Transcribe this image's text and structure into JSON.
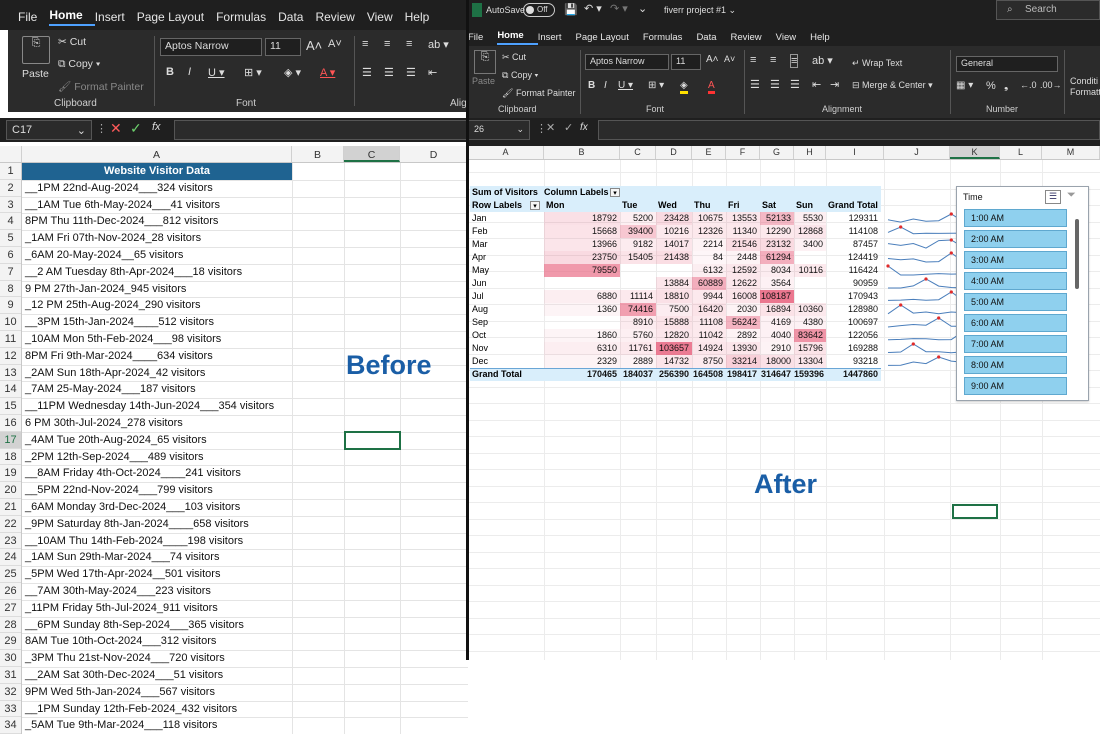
{
  "left": {
    "menu": [
      "File",
      "Home",
      "Insert",
      "Page Layout",
      "Formulas",
      "Data",
      "Review",
      "View",
      "Help"
    ],
    "active_tab": "Home",
    "clipboard": {
      "paste": "Paste",
      "cut": "Cut",
      "copy": "Copy",
      "format_painter": "Format Painter",
      "group": "Clipboard"
    },
    "font": {
      "name": "Aptos Narrow",
      "size": "11",
      "group": "Font"
    },
    "align_group": "Alig",
    "name_box": "C17",
    "fx": "fx",
    "columns": [
      "A",
      "B",
      "C",
      "D"
    ],
    "rows": [
      "1",
      "2",
      "3",
      "4",
      "5",
      "6",
      "7",
      "8",
      "9",
      "10",
      "11",
      "12",
      "13",
      "14",
      "15",
      "16",
      "17",
      "18",
      "19",
      "20",
      "21",
      "22",
      "23",
      "24",
      "25",
      "26",
      "27",
      "28",
      "29",
      "30",
      "31",
      "32",
      "33",
      "34"
    ],
    "title": "Website Visitor Data",
    "data": [
      "__1PM 22nd-Aug-2024___324 visitors",
      "__1AM   Tue 6th-May-2024___41 visitors",
      "8PM   Thu 11th-Dec-2024___812 visitors",
      "_1AM   Fri 07th-Nov-2024_28 visitors",
      "_6AM 20-May-2024__65 visitors",
      "__2 AM  Tuesday 8th-Apr-2024___18 visitors",
      "9 PM 27th-Jan-2024_945 visitors",
      "_12 PM 25th-Aug-2024_290 visitors",
      "__3PM 15th-Jan-2024____512 visitors",
      "_10AM   Mon 5th-Feb-2024___98 visitors",
      "8PM   Fri 9th-Mar-2024____634 visitors",
      "_2AM  Sun 18th-Apr-2024_42 visitors",
      "_7AM 25-May-2024___187 visitors",
      "__11PM  Wednesday 14th-Jun-2024___354 visitors",
      "6 PM 30th-Jul-2024_278 visitors",
      "_4AM  Tue 20th-Aug-2024_65 visitors",
      "_2PM  12th-Sep-2024___489 visitors",
      "__8AM  Friday 4th-Oct-2024____241 visitors",
      "__5PM  22nd-Nov-2024___799 visitors",
      "_6AM  Monday 3rd-Dec-2024___103 visitors",
      "_9PM  Saturday 8th-Jan-2024____658 visitors",
      "__10AM  Thu 14th-Feb-2024____198 visitors",
      "_1AM  Sun 29th-Mar-2024___74 visitors",
      "_5PM  Wed 17th-Apr-2024__501 visitors",
      "__7AM  30th-May-2024___223 visitors",
      "_11PM   Friday 5th-Jul-2024_911 visitors",
      "__6PM  Sunday 8th-Sep-2024___365 visitors",
      "8AM  Tue 10th-Oct-2024___312 visitors",
      "_3PM   Thu 21st-Nov-2024___720 visitors",
      "__2AM   Sat 30th-Dec-2024___51 visitors",
      "9PM  Wed 5th-Jan-2024___567 visitors",
      "__1PM   Sunday 12th-Feb-2024_432 visitors",
      "_5AM  Tue 9th-Mar-2024___118 visitors"
    ],
    "label": "Before"
  },
  "right": {
    "autosave": "AutoSave",
    "autosave_state": "Off",
    "file_name": "fiverr project #1",
    "search": "Search",
    "menu": [
      "File",
      "Home",
      "Insert",
      "Page Layout",
      "Formulas",
      "Data",
      "Review",
      "View",
      "Help"
    ],
    "active_tab": "Home",
    "clipboard": {
      "paste": "Paste",
      "cut": "Cut",
      "copy": "Copy",
      "format_painter": "Format Painter",
      "group": "Clipboard"
    },
    "font": {
      "name": "Aptos Narrow",
      "size": "11",
      "group": "Font"
    },
    "alignment": {
      "wrap": "Wrap Text",
      "merge": "Merge & Center",
      "group": "Alignment"
    },
    "number": {
      "format": "General",
      "group": "Number"
    },
    "cond_fmt": "Conditi Formatti",
    "name_box": "26",
    "fx": "fx",
    "columns": [
      "A",
      "B",
      "C",
      "D",
      "E",
      "F",
      "G",
      "H",
      "I",
      "J",
      "K",
      "L",
      "M"
    ],
    "pivot": {
      "corner": "Sum of Visitors",
      "col_labels": "Column Labels",
      "row_labels": "Row Labels",
      "days": [
        "Mon",
        "Tue",
        "Wed",
        "Thu",
        "Fri",
        "Sat",
        "Sun"
      ],
      "grand_total_label": "Grand Total",
      "months": [
        "Jan",
        "Feb",
        "Mar",
        "Apr",
        "May",
        "Jun",
        "Jul",
        "Aug",
        "Sep",
        "Oct",
        "Nov",
        "Dec"
      ],
      "values": [
        [
          "18792",
          "5200",
          "23428",
          "10675",
          "13553",
          "52133",
          "5530",
          "129311"
        ],
        [
          "15668",
          "39400",
          "10216",
          "12326",
          "11340",
          "12290",
          "12868",
          "114108"
        ],
        [
          "13966",
          "9182",
          "14017",
          "2214",
          "21546",
          "23132",
          "3400",
          "87457"
        ],
        [
          "23750",
          "15405",
          "21438",
          "84",
          "2448",
          "61294",
          "",
          "124419"
        ],
        [
          "79550",
          "",
          "",
          "6132",
          "12592",
          "8034",
          "10116",
          "116424"
        ],
        [
          "",
          "",
          "13884",
          "60889",
          "12622",
          "3564",
          "",
          "90959"
        ],
        [
          "6880",
          "11114",
          "18810",
          "9944",
          "16008",
          "108187",
          "",
          "170943"
        ],
        [
          "1360",
          "74416",
          "7500",
          "16420",
          "2030",
          "16894",
          "10360",
          "128980"
        ],
        [
          "",
          "8910",
          "15888",
          "11108",
          "56242",
          "4169",
          "4380",
          "100697"
        ],
        [
          "1860",
          "5760",
          "12820",
          "11042",
          "2892",
          "4040",
          "83642",
          "122056"
        ],
        [
          "6310",
          "11761",
          "103657",
          "14924",
          "13930",
          "2910",
          "15796",
          "169288"
        ],
        [
          "2329",
          "2889",
          "14732",
          "8750",
          "33214",
          "18000",
          "13304",
          "93218"
        ]
      ],
      "totals": [
        "170465",
        "184037",
        "256390",
        "164508",
        "198417",
        "314647",
        "159396",
        "1447860"
      ],
      "grand_total_row": "Grand Total"
    },
    "slicer": {
      "title": "Time",
      "items": [
        "1:00 AM",
        "2:00 AM",
        "3:00 AM",
        "4:00 AM",
        "5:00 AM",
        "6:00 AM",
        "7:00 AM",
        "8:00 AM",
        "9:00 AM"
      ]
    },
    "label": "After"
  },
  "colors": {
    "title_fill": "#1f6391",
    "label_blue": "#1a5ea6",
    "slicer_item": "#8fd0ee",
    "pivot_header": "#d9eefb",
    "heat_max": "#e8778e"
  }
}
